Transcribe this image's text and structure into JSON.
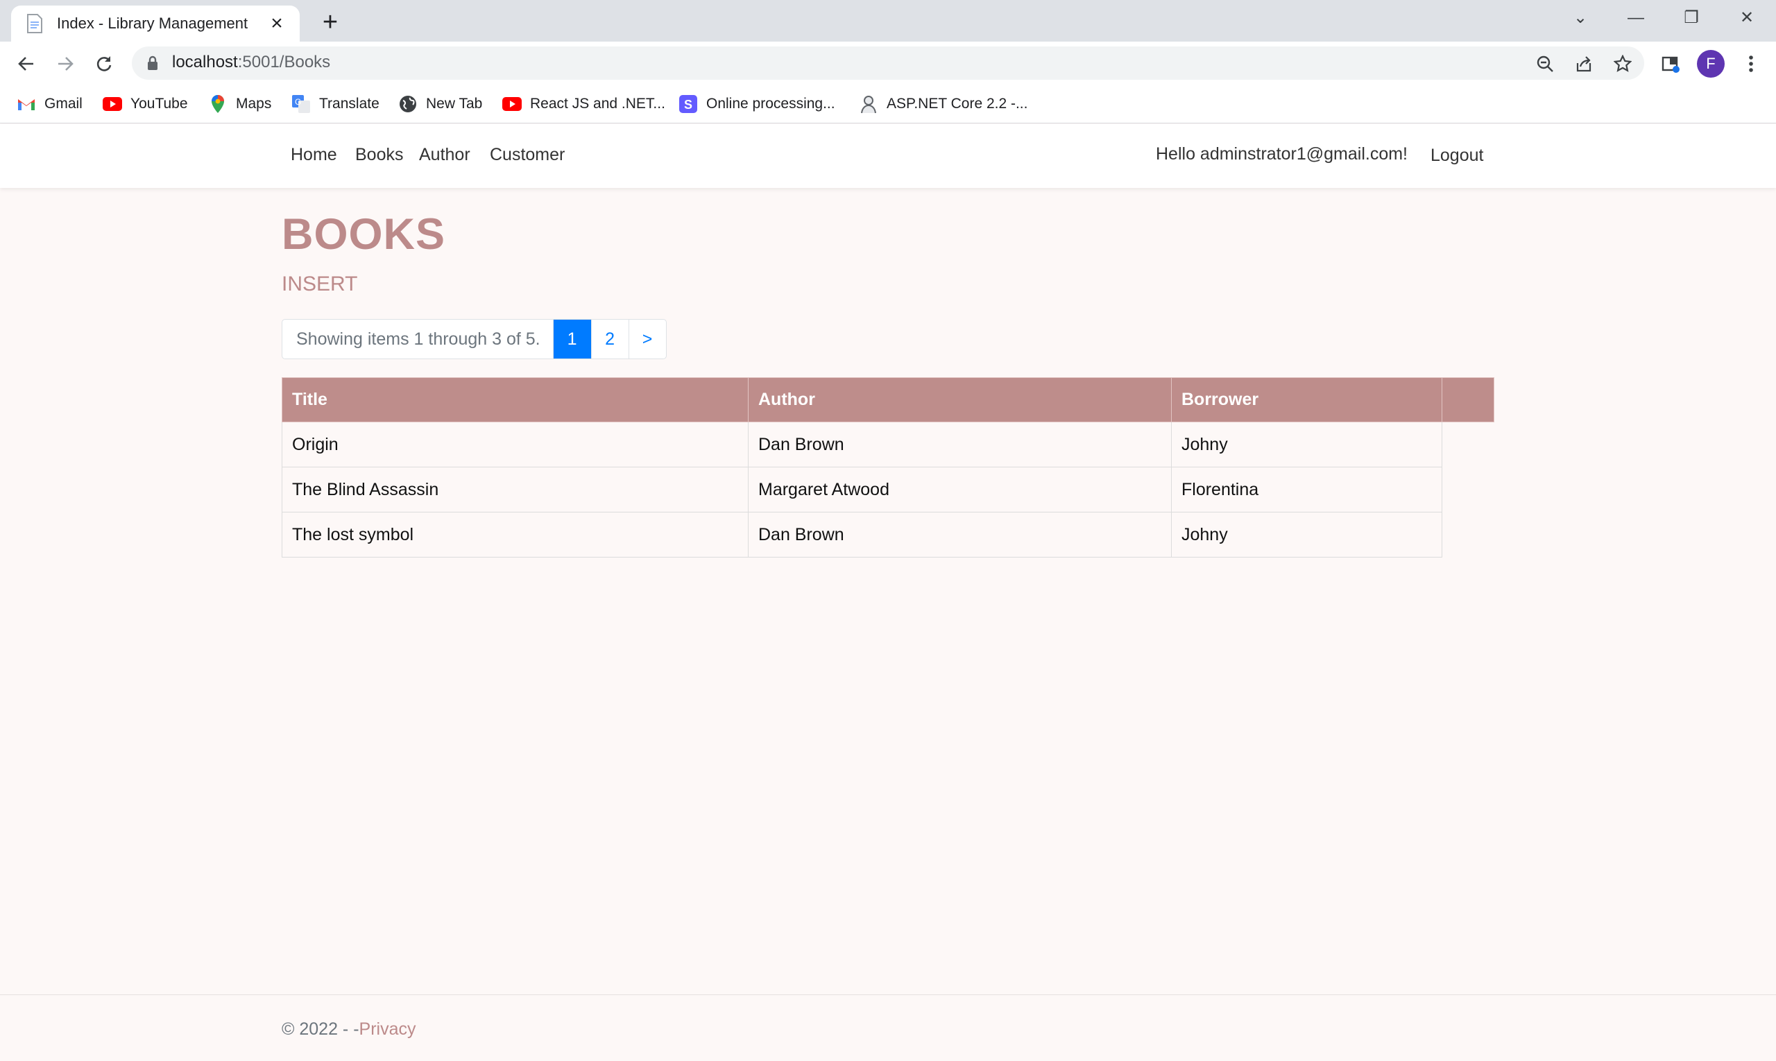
{
  "browser": {
    "tab_title": "Index - Library Management",
    "url_host": "localhost",
    "url_path": ":5001/Books",
    "bookmarks": [
      {
        "label": "Gmail",
        "icon": "gmail-icon"
      },
      {
        "label": "YouTube",
        "icon": "youtube-icon"
      },
      {
        "label": "Maps",
        "icon": "maps-icon"
      },
      {
        "label": "Translate",
        "icon": "translate-icon"
      },
      {
        "label": "New Tab",
        "icon": "globe-icon"
      },
      {
        "label": "React JS and .NET...",
        "icon": "youtube-icon"
      },
      {
        "label": "Online  processing...",
        "icon": "s-icon"
      },
      {
        "label": "ASP.NET Core 2.2 -...",
        "icon": "person-icon"
      }
    ],
    "profile_initial": "F",
    "colors": {
      "avatar": "#5e35b1",
      "tabbar": "#dee1e6"
    }
  },
  "nav": {
    "links": [
      "Home",
      "Books",
      "Author",
      "Customer"
    ],
    "greeting": "Hello adminstrator1@gmail.com!",
    "logout": "Logout"
  },
  "page": {
    "title": "BOOKS",
    "insert_label": "INSERT",
    "pager": {
      "summary": "Showing items 1 through 3 of 5.",
      "pages": [
        "1",
        "2"
      ],
      "current": "1",
      "next": ">"
    },
    "table": {
      "headers": [
        "Title",
        "Author",
        "Borrower"
      ],
      "rows": [
        [
          "Origin",
          "Dan Brown",
          "Johny"
        ],
        [
          "The Blind Assassin",
          "Margaret Atwood",
          "Florentina"
        ],
        [
          "The lost symbol",
          "Dan Brown",
          "Johny"
        ]
      ]
    },
    "colors": {
      "accent": "#bc8a8a",
      "header_bg": "#be8d8b",
      "pager_active": "#007bff"
    }
  },
  "footer": {
    "copyright": "© 2022 - -",
    "privacy": "Privacy"
  }
}
